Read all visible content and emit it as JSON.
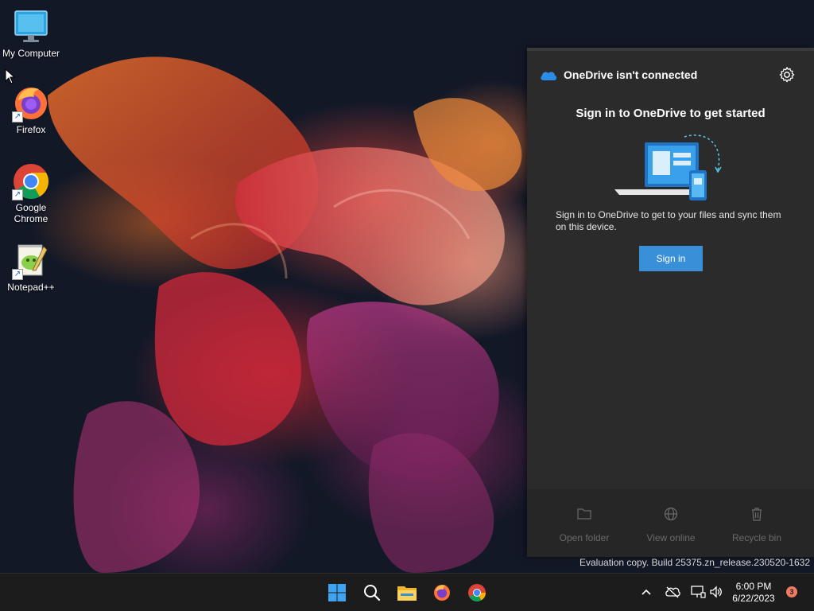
{
  "desktop": {
    "icons": [
      {
        "label": "My Computer"
      },
      {
        "label": "Firefox"
      },
      {
        "label": "Google\nChrome"
      },
      {
        "label": "Notepad++"
      }
    ]
  },
  "onedrive": {
    "title": "OneDrive isn't connected",
    "heading": "Sign in to OneDrive to get started",
    "description": "Sign in to OneDrive to get to your files and sync them on this device.",
    "signin_label": "Sign in",
    "footer": [
      {
        "label": "Open folder",
        "icon": "folder-icon"
      },
      {
        "label": "View online",
        "icon": "globe-icon"
      },
      {
        "label": "Recycle bin",
        "icon": "trash-icon"
      }
    ]
  },
  "watermark": "Evaluation copy. Build 25375.zn_release.230520-1632",
  "taskbar": {
    "apps": [
      "start-icon",
      "search-icon",
      "file-explorer-icon",
      "firefox-icon",
      "chrome-icon"
    ],
    "time": "6:00 PM",
    "date": "6/22/2023",
    "notification_count": "3"
  },
  "colors": {
    "accent": "#3a8fd9",
    "flyout_bg": "#2b2b2b",
    "taskbar_bg": "#1c1c1c",
    "badge": "#f17a64"
  }
}
